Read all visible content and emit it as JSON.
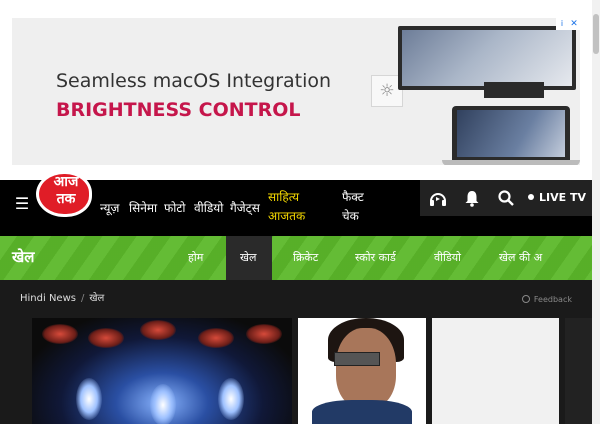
{
  "ad": {
    "line1": "Seamless macOS Integration",
    "line2": "BRIGHTNESS CONTROL",
    "brightness_icon": "sun-icon",
    "accent_color": "#c5164b",
    "info_icon": "info-icon",
    "close_icon": "close-icon"
  },
  "header": {
    "logo_line1": "आज",
    "logo_line2": "तक",
    "menu_icon": "hamburger-icon",
    "nav": [
      "न्यूज़",
      "सिनेमा",
      "फोटो",
      "वीडियो",
      "गैजेट्स"
    ],
    "sahitya_line1": "साहित्य",
    "sahitya_line2": "आजतक",
    "fact_line1": "फैक्ट",
    "fact_line2": "चेक",
    "live_label": "LIVE TV"
  },
  "section": {
    "title": "खेल",
    "tabs": [
      "होम",
      "खेल",
      "क्रिकेट",
      "स्कोर कार्ड",
      "वीडियो",
      "खेल की अ"
    ],
    "active_tab": "खेल",
    "color": "#5cb82a"
  },
  "breadcrumb": {
    "home": "Hindi News",
    "current": "खेल"
  },
  "feedback_label": "Feedback"
}
